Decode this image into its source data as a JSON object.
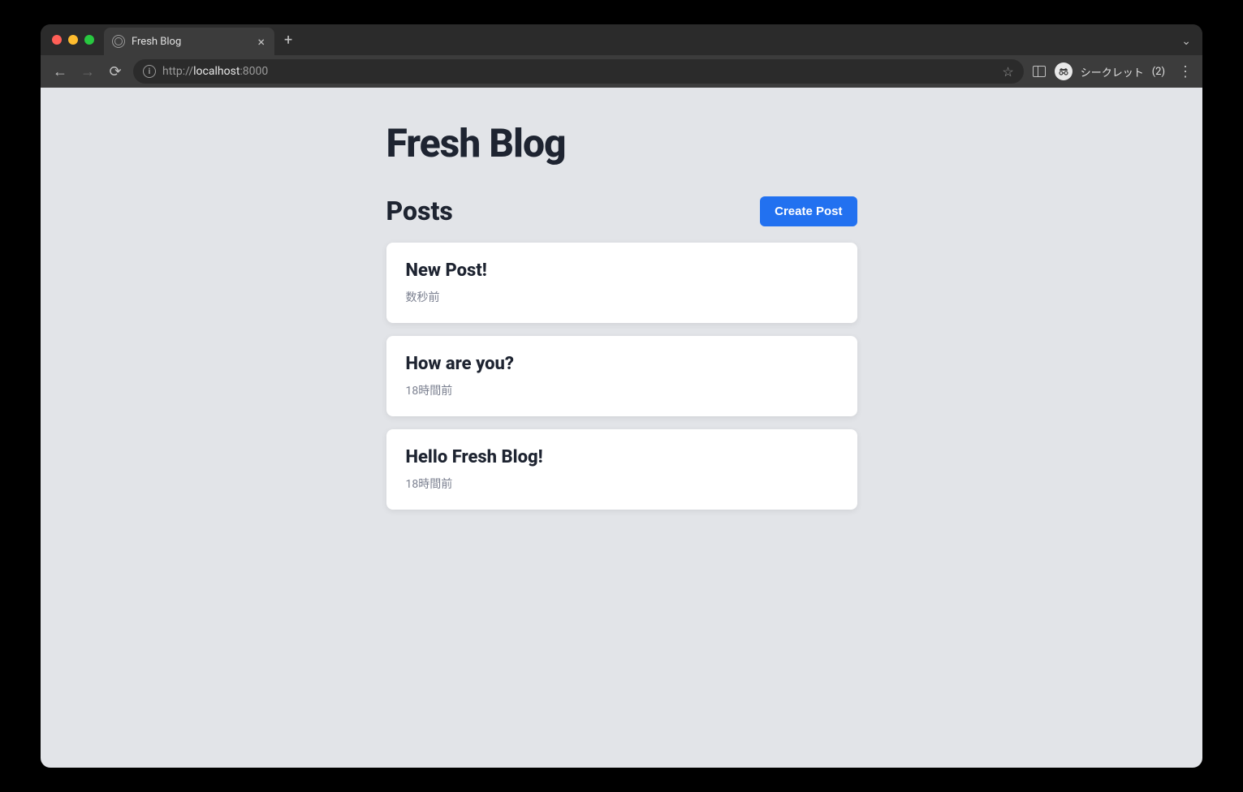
{
  "browser": {
    "tab_title": "Fresh Blog",
    "url_prefix": "http://",
    "url_host": "localhost",
    "url_port": ":8000",
    "incognito_label": "シークレット",
    "incognito_count": "(2)"
  },
  "page": {
    "title": "Fresh Blog",
    "posts_heading": "Posts",
    "create_button": "Create Post",
    "posts": [
      {
        "title": "New Post!",
        "time": "数秒前"
      },
      {
        "title": "How are you?",
        "time": "18時間前"
      },
      {
        "title": "Hello Fresh Blog!",
        "time": "18時間前"
      }
    ]
  }
}
